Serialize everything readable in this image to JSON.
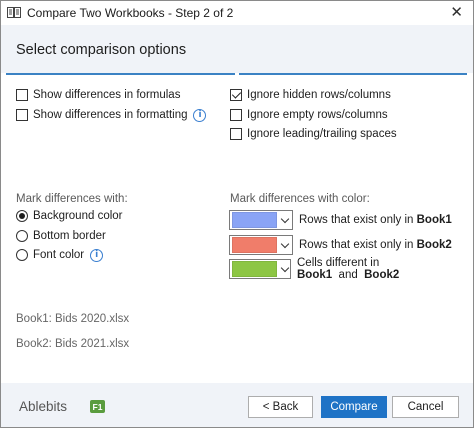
{
  "window": {
    "title": "Compare Two Workbooks - Step 2 of 2",
    "close_glyph": "✕"
  },
  "header": {
    "title": "Select comparison options"
  },
  "options_left": [
    {
      "label": "Show differences in formulas",
      "checked": false
    },
    {
      "label": "Show differences in formatting",
      "checked": false,
      "info": true
    }
  ],
  "options_right": [
    {
      "label": "Ignore hidden rows/columns",
      "checked": true
    },
    {
      "label": "Ignore empty rows/columns",
      "checked": false
    },
    {
      "label": "Ignore leading/trailing spaces",
      "checked": false
    }
  ],
  "mark_with": {
    "label": "Mark differences with:",
    "options": [
      {
        "label": "Background color",
        "selected": true
      },
      {
        "label": "Bottom border",
        "selected": false
      },
      {
        "label": "Font color",
        "selected": false,
        "info": true
      }
    ]
  },
  "mark_color": {
    "label": "Mark differences with color:",
    "rows": [
      {
        "color": "#8aa4f5",
        "text_pre": "Rows that exist only in ",
        "book": "Book1",
        "text_mid": "",
        "book2": ""
      },
      {
        "color": "#f07d6a",
        "text_pre": "Rows that exist only in ",
        "book": "Book2",
        "text_mid": "",
        "book2": ""
      },
      {
        "color": "#8dc644",
        "text_pre": "Cells different in ",
        "book": "Book1",
        "text_mid": "and",
        "book2": "Book2"
      }
    ]
  },
  "books": {
    "book1": "Book1: Bids 2020.xlsx",
    "book2": "Book2: Bids 2021.xlsx"
  },
  "footer": {
    "brand": "Ablebits",
    "help_badge": "F1",
    "back_label": "< Back",
    "compare_label": "Compare",
    "cancel_label": "Cancel"
  },
  "icons": {
    "app": "workbook-compare-icon",
    "info": "info-icon",
    "dropdown": "chevron-down-icon",
    "close": "close-icon"
  }
}
